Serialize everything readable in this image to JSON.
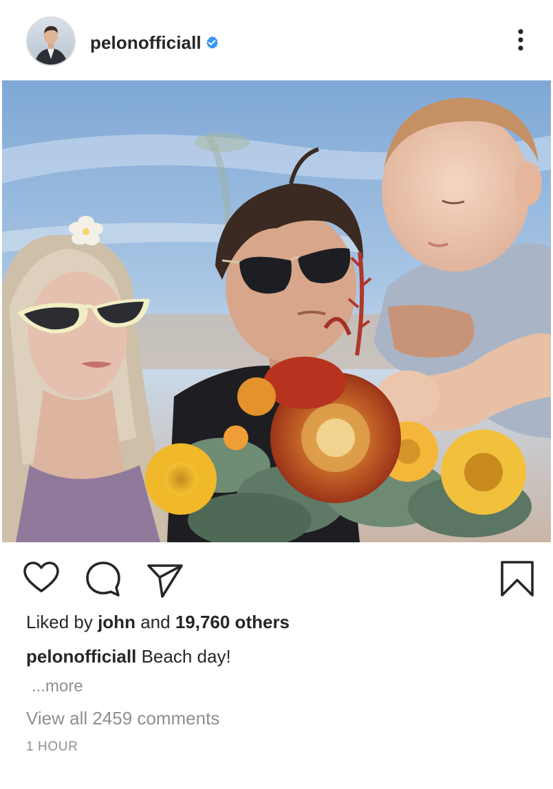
{
  "post": {
    "username": "pelonofficiall",
    "verified": true,
    "avatar_icon": "profile-avatar",
    "menu_icon": "more-options-vertical-icon"
  },
  "actions": {
    "like_icon": "heart-icon",
    "comment_icon": "comment-icon",
    "share_icon": "send-icon",
    "save_icon": "bookmark-icon"
  },
  "likes": {
    "prefix": "Liked by",
    "user": "john",
    "conjunction": "and",
    "others": "19,760 others"
  },
  "caption": {
    "username": "pelonofficiall",
    "text": "Beach day!"
  },
  "more_label": "...more",
  "view_comments": "View all 2459 comments",
  "timestamp": "1 HOUR",
  "colors": {
    "text": "#262626",
    "secondary": "#8e8e8e",
    "verified_blue": "#3897f0",
    "border": "#efefef"
  }
}
